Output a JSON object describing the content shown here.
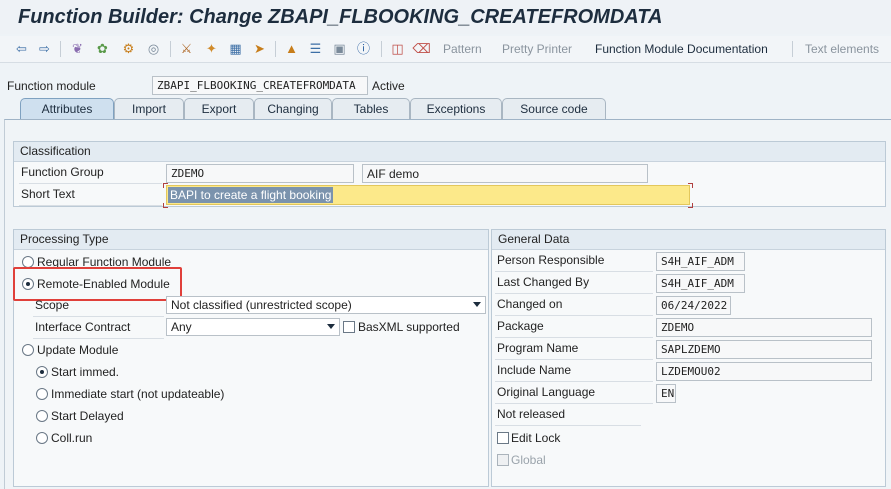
{
  "window": {
    "title": "Function Builder: Change ZBAPI_FLBOOKING_CREATEFROMDATA"
  },
  "toolbar": {
    "icons": [
      "back-arrow-icon",
      "forward-arrow-icon",
      "other-object-icon",
      "check-icon",
      "activate-icon",
      "test-icon",
      "where-used-icon",
      "display-object-list-icon",
      "enhancement-icon",
      "navigation-icon",
      "hierarchy-icon",
      "outline-icon",
      "screen-icon",
      "info-icon",
      "insert-icon",
      "delete-icon"
    ],
    "pattern": "Pattern",
    "pretty_printer": "Pretty Printer",
    "fm_documentation": "Function Module Documentation",
    "text_elements": "Text elements"
  },
  "header": {
    "fm_label": "Function module",
    "fm_value": "ZBAPI_FLBOOKING_CREATEFROMDATA",
    "status": "Active"
  },
  "tabs": [
    {
      "label": "Attributes",
      "active": true
    },
    {
      "label": "Import",
      "active": false
    },
    {
      "label": "Export",
      "active": false
    },
    {
      "label": "Changing",
      "active": false
    },
    {
      "label": "Tables",
      "active": false
    },
    {
      "label": "Exceptions",
      "active": false
    },
    {
      "label": "Source code",
      "active": false
    }
  ],
  "classification": {
    "title": "Classification",
    "function_group_label": "Function Group",
    "function_group_value": "ZDEMO",
    "function_group_desc": "AIF demo",
    "short_text_label": "Short Text",
    "short_text_value": "BAPI to create a flight booking"
  },
  "processing": {
    "title": "Processing Type",
    "regular": "Regular Function Module",
    "remote": "Remote-Enabled Module",
    "scope_label": "Scope",
    "scope_value": "Not classified (unrestricted scope)",
    "interface_label": "Interface Contract",
    "interface_value": "Any",
    "basxml_label": "BasXML supported",
    "update_module": "Update Module",
    "start_immed": "Start immed.",
    "immediate_start": "Immediate start (not updateable)",
    "start_delayed": "Start Delayed",
    "coll_run": "Coll.run"
  },
  "general": {
    "title": "General Data",
    "person_label": "Person Responsible",
    "person_value": "S4H_AIF_ADM",
    "last_changed_label": "Last Changed By",
    "last_changed_value": "S4H_AIF_ADM",
    "changed_on_label": "Changed on",
    "changed_on_value": "06/24/2022",
    "package_label": "Package",
    "package_value": "ZDEMO",
    "program_label": "Program Name",
    "program_value": "SAPLZDEMO",
    "include_label": "Include Name",
    "include_value": "LZDEMOU02",
    "language_label": "Original Language",
    "language_value": "EN",
    "not_released": "Not released",
    "edit_lock": "Edit Lock",
    "global": "Global"
  },
  "colors": {
    "highlight_box": "#e0403a",
    "short_text_bg": "#fce98a",
    "active_tab": "#cfe0ef"
  }
}
